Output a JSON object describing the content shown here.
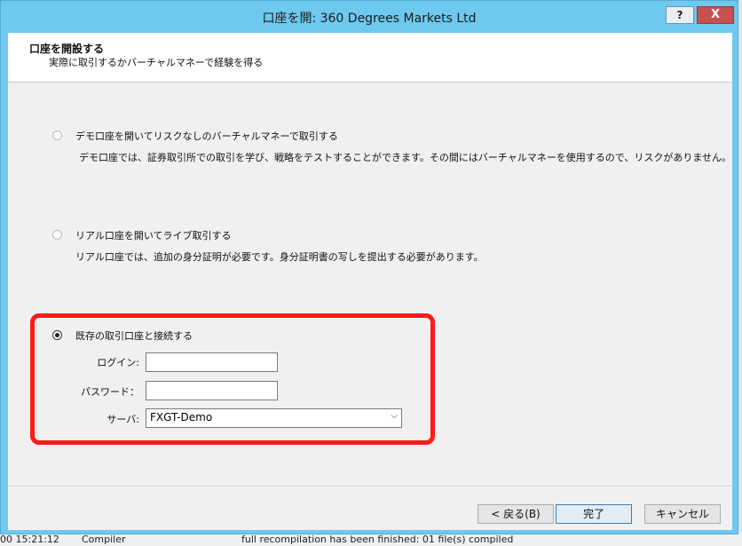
{
  "window": {
    "title": "口座を開: 360 Degrees Markets Ltd",
    "help_label": "?",
    "close_label": "X"
  },
  "header": {
    "title": "口座を開設する",
    "subtitle": "実際に取引するかバーチャルマネーで経験を得る"
  },
  "options": {
    "demo": {
      "label": "デモ口座を開いてリスクなしのバーチャルマネーで取引する",
      "description": "デモ口座では、証券取引所での取引を学び、戦略をテストすることができます。その間にはバーチャルマネーを使用するので、リスクがありません。",
      "selected": false
    },
    "real": {
      "label": "リアル口座を開いてライブ取引する",
      "description": "リアル口座では、追加の身分証明が必要です。身分証明書の写しを提出する必要があります。",
      "selected": false
    },
    "existing": {
      "label": "既存の取引口座と接続する",
      "selected": true,
      "login_label": "ログイン:",
      "login_value": "",
      "password_label": "パスワード：",
      "password_value": "",
      "server_label": "サーバ:",
      "server_value": "FXGT-Demo"
    }
  },
  "buttons": {
    "back": "< 戻る(B)",
    "finish": "完了",
    "cancel": "キャンセル"
  },
  "background_status": {
    "time": "00 15:21:12",
    "source": "Compiler",
    "message": "full recompilation has been finished: 01 file(s) compiled"
  },
  "colors": {
    "titlebar": "#6ec9ee",
    "highlight": "#ff1a1a",
    "close_button": "#c75050"
  }
}
